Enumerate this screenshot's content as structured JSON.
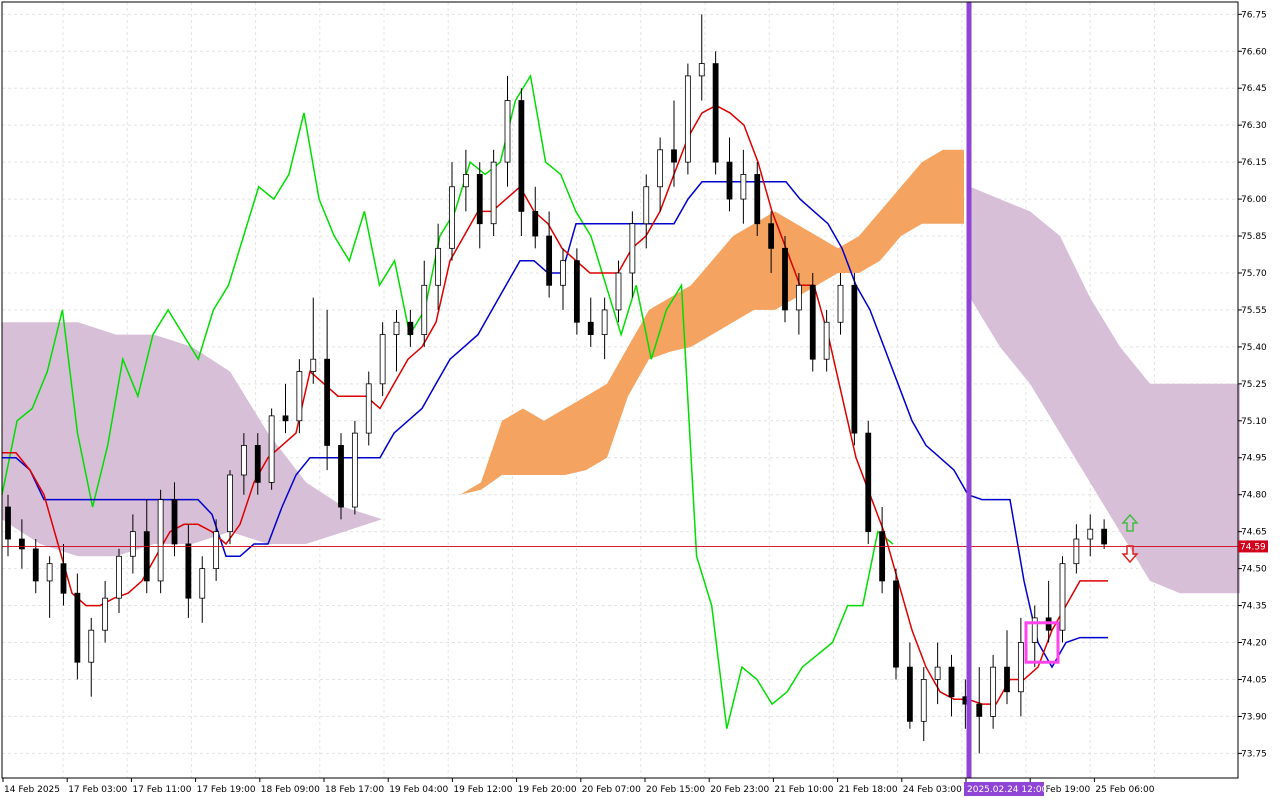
{
  "chart_data": {
    "type": "candlestick",
    "instrument_note": "",
    "y_axis": {
      "min": 73.65,
      "max": 76.8,
      "ticks": [
        "76.75",
        "76.60",
        "76.45",
        "76.30",
        "76.15",
        "76.00",
        "75.85",
        "75.70",
        "75.55",
        "75.40",
        "75.25",
        "75.10",
        "74.95",
        "74.80",
        "74.65",
        "74.50",
        "74.35",
        "74.20",
        "74.05",
        "73.90",
        "73.75"
      ]
    },
    "x_axis": {
      "tick_labels": [
        "14 Feb 2025",
        "17 Feb 03:00",
        "17 Feb 11:00",
        "17 Feb 19:00",
        "18 Feb 09:00",
        "18 Feb 17:00",
        "19 Feb 04:00",
        "19 Feb 12:00",
        "19 Feb 20:00",
        "20 Feb 07:00",
        "20 Feb 15:00",
        "20 Feb 23:00",
        "21 Feb 10:00",
        "21 Feb 18:00",
        "24 Feb 03:00",
        "",
        "24 Feb 19:00",
        "25 Feb 06:00"
      ],
      "highlight_label": "2025.02.24 12:00",
      "highlight_index": 15
    },
    "current_price": {
      "value": 74.59,
      "label": "74.59",
      "color": "#d0021b"
    },
    "grid": true,
    "colors": {
      "tenkan": "#dd0000",
      "kijun": "#0000cc",
      "chikou": "#00dd00",
      "cloud_bull": "#f4a460",
      "cloud_bear": "#d8bfd8",
      "vertical_marker": "#8e44d4",
      "box_marker": "#ff44ee",
      "arrow_up": "#44bb44",
      "arrow_down": "#dd2222",
      "bull_candle": "#ffffff",
      "bear_candle": "#000000"
    },
    "candles": [
      [
        74.75,
        74.8,
        74.55,
        74.62
      ],
      [
        74.62,
        74.7,
        74.5,
        74.58
      ],
      [
        74.58,
        74.62,
        74.4,
        74.45
      ],
      [
        74.45,
        74.55,
        74.3,
        74.52
      ],
      [
        74.52,
        74.6,
        74.35,
        74.4
      ],
      [
        74.4,
        74.48,
        74.05,
        74.12
      ],
      [
        74.12,
        74.3,
        73.98,
        74.25
      ],
      [
        74.25,
        74.45,
        74.2,
        74.38
      ],
      [
        74.38,
        74.58,
        74.32,
        74.55
      ],
      [
        74.55,
        74.72,
        74.48,
        74.65
      ],
      [
        74.65,
        74.78,
        74.4,
        74.45
      ],
      [
        74.45,
        74.82,
        74.4,
        74.78
      ],
      [
        74.78,
        74.85,
        74.55,
        74.6
      ],
      [
        74.6,
        74.68,
        74.3,
        74.38
      ],
      [
        74.38,
        74.55,
        74.28,
        74.5
      ],
      [
        74.5,
        74.7,
        74.45,
        74.65
      ],
      [
        74.65,
        74.9,
        74.6,
        74.88
      ],
      [
        74.88,
        75.05,
        74.8,
        75.0
      ],
      [
        75.0,
        75.05,
        74.8,
        74.85
      ],
      [
        74.85,
        75.15,
        74.82,
        75.12
      ],
      [
        75.12,
        75.25,
        75.05,
        75.1
      ],
      [
        75.1,
        75.35,
        75.05,
        75.3
      ],
      [
        75.3,
        75.6,
        75.25,
        75.35
      ],
      [
        75.35,
        75.55,
        74.9,
        75.0
      ],
      [
        75.0,
        75.05,
        74.7,
        74.75
      ],
      [
        74.75,
        75.1,
        74.72,
        75.05
      ],
      [
        75.05,
        75.3,
        75.0,
        75.25
      ],
      [
        75.25,
        75.5,
        75.2,
        75.45
      ],
      [
        75.45,
        75.55,
        75.3,
        75.5
      ],
      [
        75.5,
        75.55,
        75.4,
        75.45
      ],
      [
        75.45,
        75.75,
        75.4,
        75.65
      ],
      [
        75.65,
        75.9,
        75.55,
        75.8
      ],
      [
        75.8,
        76.15,
        75.75,
        76.05
      ],
      [
        76.05,
        76.2,
        75.95,
        76.1
      ],
      [
        76.1,
        76.15,
        75.8,
        75.9
      ],
      [
        75.9,
        76.2,
        75.85,
        76.15
      ],
      [
        76.15,
        76.5,
        76.05,
        76.4
      ],
      [
        76.4,
        76.45,
        75.85,
        75.95
      ],
      [
        75.95,
        76.05,
        75.8,
        75.85
      ],
      [
        75.85,
        75.95,
        75.6,
        75.65
      ],
      [
        75.65,
        75.8,
        75.55,
        75.75
      ],
      [
        75.75,
        75.8,
        75.45,
        75.5
      ],
      [
        75.5,
        75.6,
        75.4,
        75.45
      ],
      [
        75.45,
        75.6,
        75.35,
        75.55
      ],
      [
        75.55,
        75.75,
        75.5,
        75.7
      ],
      [
        75.7,
        75.95,
        75.6,
        75.9
      ],
      [
        75.9,
        76.1,
        75.8,
        76.05
      ],
      [
        76.05,
        76.25,
        75.95,
        76.2
      ],
      [
        76.2,
        76.4,
        76.05,
        76.15
      ],
      [
        76.15,
        76.55,
        76.1,
        76.5
      ],
      [
        76.5,
        76.75,
        76.4,
        76.55
      ],
      [
        76.55,
        76.6,
        76.1,
        76.15
      ],
      [
        76.15,
        76.25,
        75.95,
        76.0
      ],
      [
        76.0,
        76.2,
        75.9,
        76.1
      ],
      [
        76.1,
        76.15,
        75.85,
        75.9
      ],
      [
        75.9,
        75.95,
        75.7,
        75.8
      ],
      [
        75.8,
        75.85,
        75.5,
        75.55
      ],
      [
        75.55,
        75.7,
        75.45,
        75.65
      ],
      [
        75.65,
        75.7,
        75.3,
        75.35
      ],
      [
        75.35,
        75.55,
        75.3,
        75.5
      ],
      [
        75.5,
        75.7,
        75.45,
        75.65
      ],
      [
        75.65,
        75.7,
        75.0,
        75.05
      ],
      [
        75.05,
        75.1,
        74.6,
        74.65
      ],
      [
        74.65,
        74.75,
        74.4,
        74.45
      ],
      [
        74.45,
        74.5,
        74.05,
        74.1
      ],
      [
        74.1,
        74.2,
        73.85,
        73.88
      ],
      [
        73.88,
        74.1,
        73.8,
        74.05
      ],
      [
        74.05,
        74.2,
        73.95,
        74.1
      ],
      [
        74.1,
        74.15,
        73.9,
        73.98
      ],
      [
        73.98,
        74.05,
        73.85,
        73.95
      ],
      [
        73.95,
        74.1,
        73.75,
        73.9
      ],
      [
        73.9,
        74.15,
        73.85,
        74.1
      ],
      [
        74.1,
        74.25,
        73.95,
        74.0
      ],
      [
        74.0,
        74.3,
        73.9,
        74.2
      ],
      [
        74.2,
        74.35,
        74.1,
        74.3
      ],
      [
        74.3,
        74.45,
        74.2,
        74.25
      ],
      [
        74.25,
        74.55,
        74.2,
        74.52
      ],
      [
        74.52,
        74.68,
        74.48,
        74.62
      ],
      [
        74.62,
        74.72,
        74.55,
        74.66
      ],
      [
        74.66,
        74.7,
        74.58,
        74.6
      ]
    ],
    "tenkan": [
      74.97,
      74.97,
      74.9,
      74.8,
      74.6,
      74.4,
      74.35,
      74.35,
      74.38,
      74.4,
      74.45,
      74.55,
      74.65,
      74.68,
      74.68,
      74.65,
      74.6,
      74.68,
      74.85,
      74.95,
      75.0,
      75.05,
      75.3,
      75.25,
      75.2,
      75.2,
      75.2,
      75.15,
      75.25,
      75.35,
      75.4,
      75.5,
      75.75,
      75.85,
      75.95,
      75.95,
      76.0,
      76.05,
      75.95,
      75.9,
      75.8,
      75.75,
      75.7,
      75.7,
      75.7,
      75.8,
      75.85,
      75.95,
      76.1,
      76.25,
      76.35,
      76.38,
      76.35,
      76.3,
      76.15,
      75.95,
      75.8,
      75.65,
      75.65,
      75.45,
      75.2,
      74.95,
      74.8,
      74.65,
      74.45,
      74.25,
      74.1,
      74.0,
      73.97,
      73.97,
      73.95,
      73.95,
      74.05,
      74.05,
      74.1,
      74.25,
      74.35,
      74.45,
      74.45,
      74.45
    ],
    "kijun": [
      74.95,
      74.95,
      74.9,
      74.78,
      74.78,
      74.78,
      74.78,
      74.78,
      74.78,
      74.78,
      74.78,
      74.78,
      74.78,
      74.78,
      74.78,
      74.72,
      74.55,
      74.55,
      74.6,
      74.6,
      74.75,
      74.88,
      74.95,
      74.95,
      74.95,
      74.95,
      74.95,
      74.95,
      75.05,
      75.1,
      75.15,
      75.25,
      75.35,
      75.4,
      75.45,
      75.55,
      75.65,
      75.75,
      75.75,
      75.7,
      75.7,
      75.9,
      75.9,
      75.9,
      75.9,
      75.9,
      75.9,
      75.9,
      75.9,
      76.0,
      76.07,
      76.07,
      76.07,
      76.07,
      76.07,
      76.07,
      76.07,
      76.0,
      75.95,
      75.9,
      75.8,
      75.65,
      75.55,
      75.4,
      75.25,
      75.1,
      75.0,
      74.95,
      74.9,
      74.8,
      74.78,
      74.78,
      74.78,
      74.45,
      74.2,
      74.1,
      74.2,
      74.22,
      74.22,
      74.22
    ],
    "chikou": [
      74.8,
      75.1,
      75.15,
      75.3,
      75.55,
      75.05,
      74.75,
      75.0,
      75.35,
      75.2,
      75.45,
      75.55,
      75.45,
      75.35,
      75.55,
      75.65,
      75.85,
      76.05,
      76.0,
      76.1,
      76.35,
      76.0,
      75.85,
      75.75,
      75.95,
      75.65,
      75.75,
      75.45,
      75.55,
      75.85,
      75.95,
      76.15,
      76.1,
      76.15,
      76.4,
      76.5,
      76.15,
      76.1,
      75.95,
      75.85,
      75.65,
      75.45,
      75.65,
      75.35,
      75.55,
      75.65,
      74.55,
      74.35,
      73.85,
      74.1,
      74.05,
      73.95,
      74.0,
      74.1,
      74.15,
      74.2,
      74.35,
      74.35,
      74.65,
      74.6
    ],
    "cloud_bull_upper": [
      74.8,
      74.85,
      75.1,
      75.15,
      75.1,
      75.15,
      75.2,
      75.25,
      75.4,
      75.55,
      75.6,
      75.65,
      75.75,
      75.85,
      75.9,
      75.95,
      75.9,
      75.85,
      75.8,
      75.85,
      75.95,
      76.05,
      76.15,
      76.2,
      76.2
    ],
    "cloud_bull_lower": [
      74.8,
      74.82,
      74.88,
      74.88,
      74.88,
      74.88,
      74.9,
      74.95,
      75.2,
      75.35,
      75.38,
      75.4,
      75.45,
      75.5,
      75.55,
      75.55,
      75.6,
      75.65,
      75.7,
      75.7,
      75.75,
      75.85,
      75.9,
      75.9,
      75.9
    ],
    "cloud_bear_upper": [
      75.5,
      75.5,
      75.5,
      75.45,
      75.45,
      75.4,
      75.3,
      75.05,
      74.85,
      74.75,
      74.7,
      74.75,
      74.75,
      76.05,
      76.0,
      75.95,
      75.85,
      75.6,
      75.4,
      75.25,
      75.25,
      75.25,
      75.25
    ],
    "cloud_bear_lower": [
      74.7,
      74.6,
      74.55,
      74.55,
      74.6,
      74.6,
      74.65,
      74.6,
      74.6,
      74.65,
      74.7,
      74.75,
      74.75,
      75.6,
      75.4,
      75.25,
      75.05,
      74.85,
      74.65,
      74.45,
      74.4,
      74.4,
      74.4
    ]
  }
}
